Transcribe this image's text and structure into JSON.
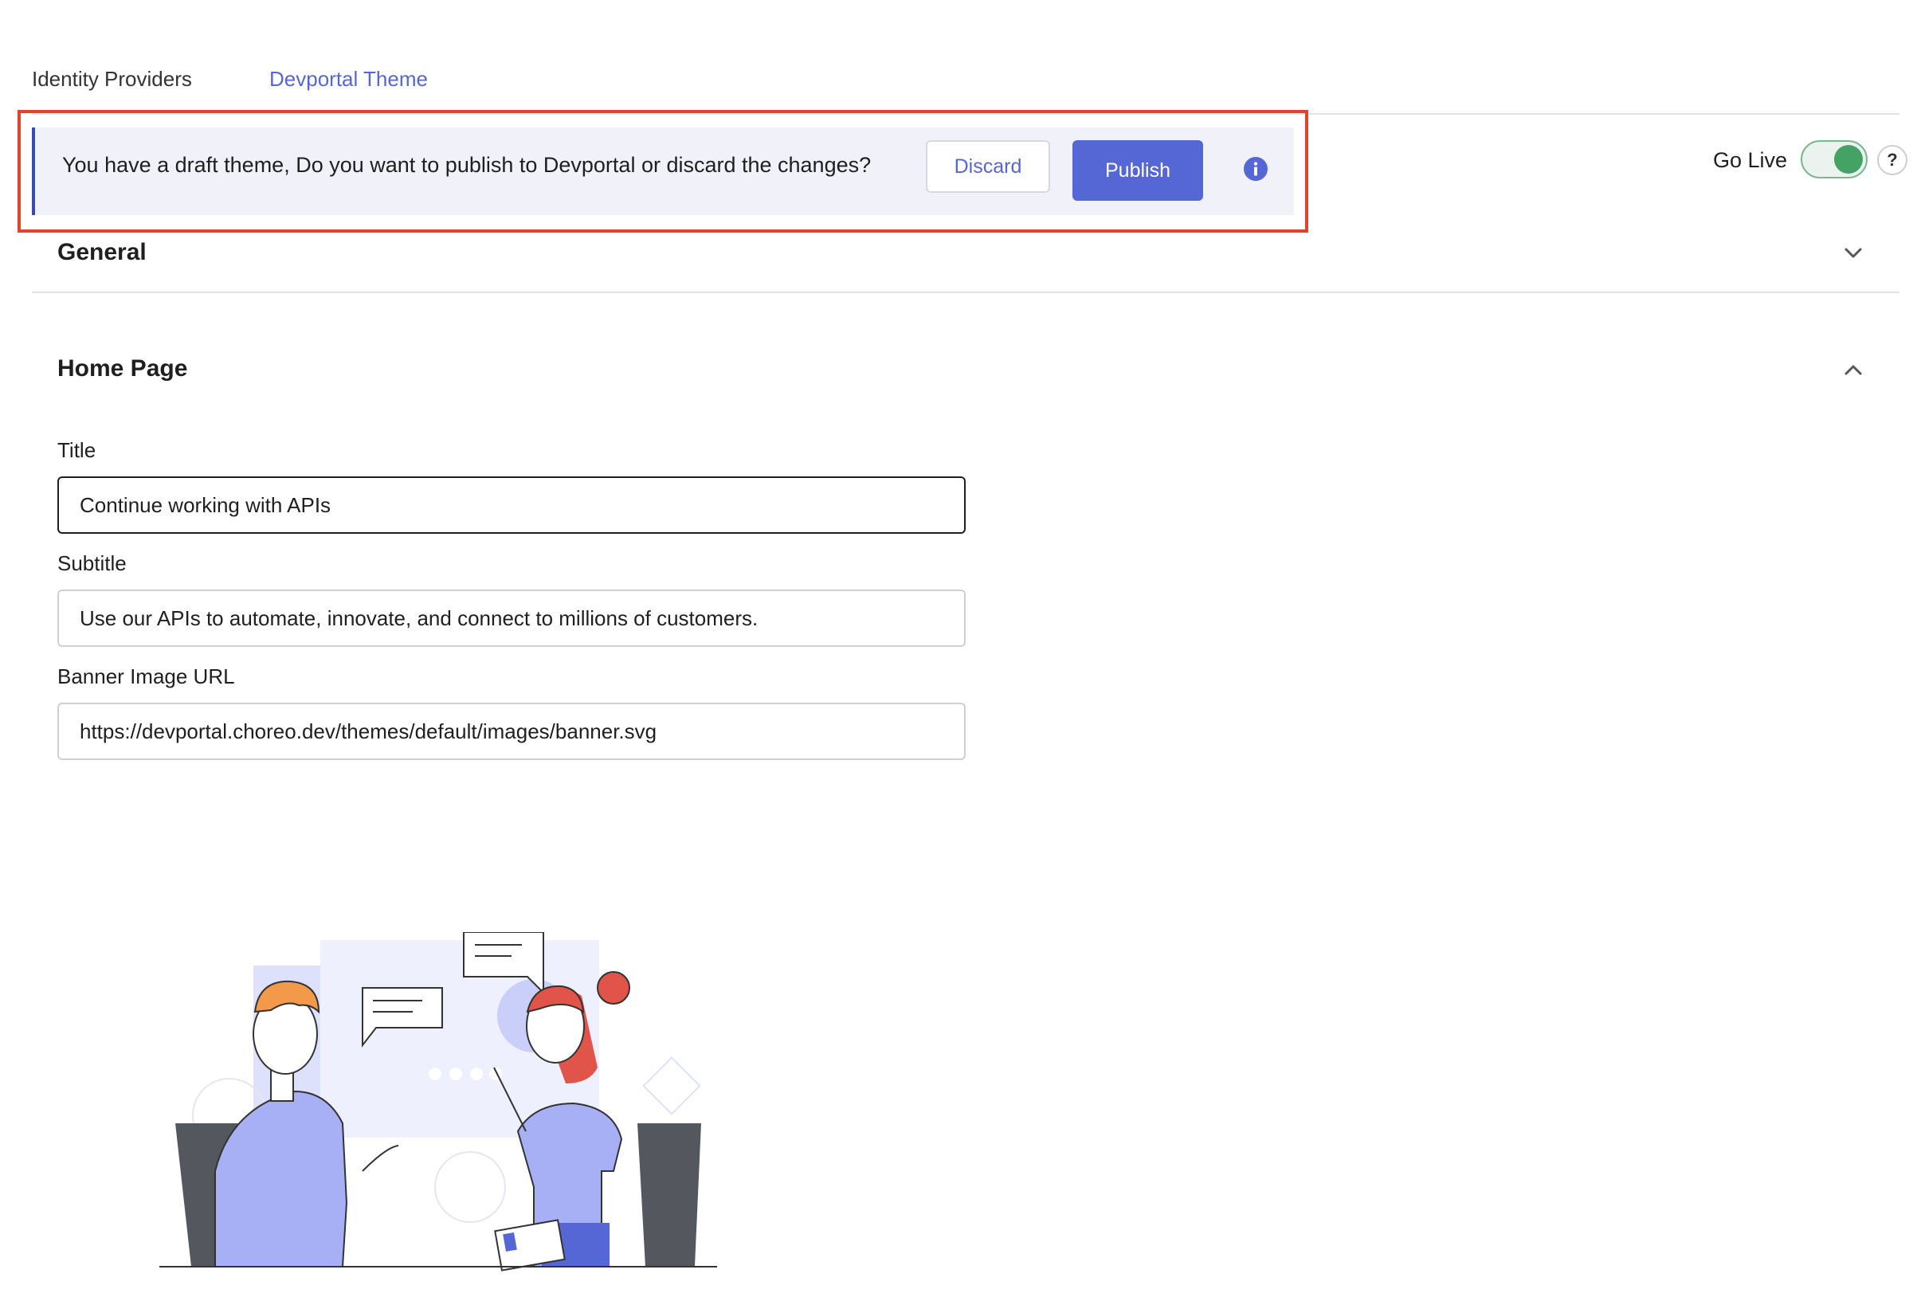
{
  "tabs": [
    {
      "label": "Identity Providers",
      "active": false
    },
    {
      "label": "Devportal Theme",
      "active": true
    }
  ],
  "banner": {
    "message": "You have a draft theme, Do you want to publish to Devportal or discard the changes?",
    "discard_label": "Discard",
    "publish_label": "Publish",
    "info_icon": "info-icon"
  },
  "go_live": {
    "label": "Go Live",
    "enabled": true,
    "help_label": "?"
  },
  "sections": {
    "general": {
      "title": "General",
      "expanded": false
    },
    "home_page": {
      "title": "Home Page",
      "expanded": true
    }
  },
  "form": {
    "title": {
      "label": "Title",
      "value": "Continue working with APIs"
    },
    "subtitle": {
      "label": "Subtitle",
      "value": "Use our APIs to automate, innovate, and connect to millions of customers."
    },
    "banner_url": {
      "label": "Banner Image URL",
      "value": "https://devportal.choreo.dev/themes/default/images/banner.svg"
    }
  },
  "colors": {
    "accent": "#5567d5",
    "highlight": "#e0452b",
    "toggle_on": "#45a265",
    "illustration_purple": "#a7b0f5",
    "illustration_orange": "#f2994a",
    "illustration_red": "#e0544a"
  }
}
